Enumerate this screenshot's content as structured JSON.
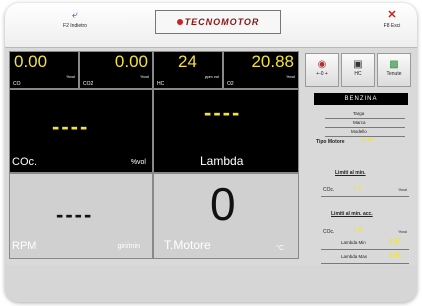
{
  "toolbar": {
    "back_label": "F2 Indietro",
    "exit_label": "F8 Esci",
    "logo_text": "TECNOMOTOR"
  },
  "gas": [
    {
      "value": "0.00",
      "name": "CO",
      "unit": "%vol"
    },
    {
      "value": "0.00",
      "name": "CO2",
      "unit": "%vol"
    },
    {
      "value": "24",
      "name": "HC",
      "unit": "ppm vol"
    },
    {
      "value": "20.88",
      "name": "O2",
      "unit": "%vol"
    }
  ],
  "panels": {
    "coc": {
      "value": "----",
      "label": "COc.",
      "unit": "%vol"
    },
    "lambda": {
      "value": "----",
      "label": "Lambda"
    },
    "rpm": {
      "value": "----",
      "label": "RPM",
      "unit": "giri/min"
    },
    "temp": {
      "value": "0",
      "label": "T.Motore",
      "unit": "°C"
    }
  },
  "side_buttons": [
    {
      "label": "+-0 +",
      "icon": "engine-icon"
    },
    {
      "label": "HC",
      "icon": "hc-icon"
    },
    {
      "label": "Tenute",
      "icon": "seal-icon"
    }
  ],
  "fuel": "BENZINA",
  "vehicle": {
    "targa": "Targa",
    "marca": "Marca",
    "modello": "Modello",
    "tipo_motore_label": "Tipo Motore",
    "tipo_motore_value": "CAT"
  },
  "limits_min": {
    "title": "Limiti al min.",
    "co_label": "COc.",
    "co_value": "0.5",
    "co_unit": "%vol"
  },
  "limits_acc": {
    "title": "Limiti al min. acc.",
    "co_label": "COc.",
    "co_value": "0.3",
    "co_unit": "%vol",
    "lambda_min_label": "Lambda Min",
    "lambda_min_value": "0.97",
    "lambda_max_label": "Lambda Max",
    "lambda_max_value": "1.03"
  },
  "colors": {
    "accent": "#f4e23a",
    "panel_black": "#000000",
    "panel_grey": "#d0d0d0"
  }
}
